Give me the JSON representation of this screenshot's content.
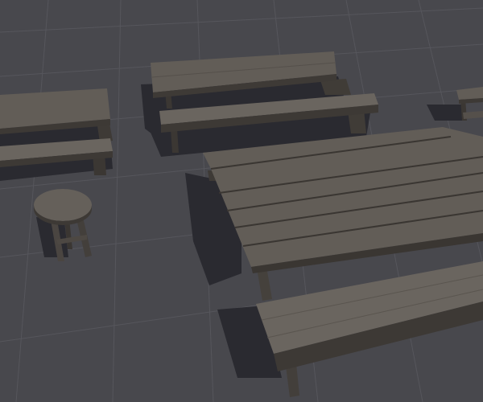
{
  "scene": {
    "objects": [
      "table-back-center",
      "bench-back-center",
      "table-left",
      "bench-left",
      "stool",
      "table-large",
      "bench-front",
      "table-far-right"
    ]
  },
  "colors": {
    "background": "#48484d",
    "grid": "#55555b",
    "wood_top": "#5f5a55",
    "wood_light": "#6d6862",
    "wood_side": "#3d3935",
    "shadow": "#2a2a2e"
  }
}
